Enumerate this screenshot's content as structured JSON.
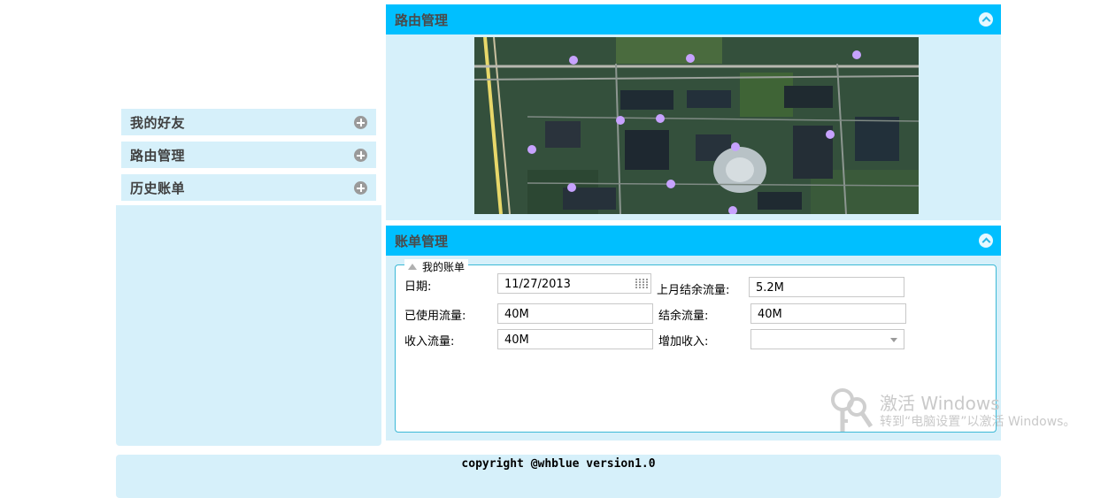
{
  "sidebar": {
    "items": [
      {
        "label": "我的好友"
      },
      {
        "label": "路由管理"
      },
      {
        "label": "历史账单"
      }
    ]
  },
  "route_panel": {
    "title": "路由管理"
  },
  "bill_panel": {
    "title": "账单管理",
    "legend": "我的账单",
    "fields": {
      "date_label": "日期:",
      "date_value": "11/27/2013",
      "last_month_label": "上月结余流量:",
      "last_month_value": "5.2M",
      "used_label": "已使用流量:",
      "used_value": "40M",
      "balance_label": "结余流量:",
      "balance_value": "40M",
      "income_label": "收入流量:",
      "income_value": "40M",
      "add_income_label": "增加收入:",
      "add_income_value": ""
    }
  },
  "watermark": {
    "title": "激活 Windows",
    "subtitle": "转到“电脑设置”以激活 Windows。"
  },
  "footer": {
    "copyright": "copyright @whblue version1.0"
  },
  "colors": {
    "header_blue": "#00bfff",
    "panel_bg": "#d6f0fa",
    "border_cyan": "#3cb9d6"
  }
}
